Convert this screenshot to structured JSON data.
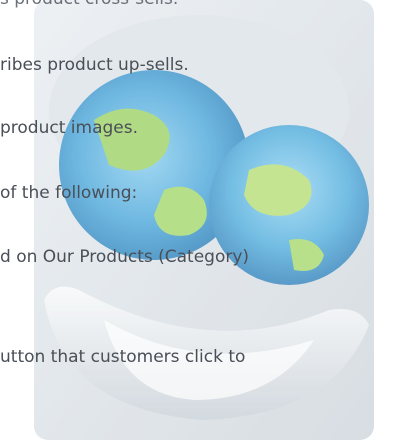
{
  "lines": [
    "s product cross-sells.",
    "ribes product up-sells.",
    " product images.",
    " of the following:",
    "d on Our Products (Category)",
    "utton that customers click to"
  ]
}
